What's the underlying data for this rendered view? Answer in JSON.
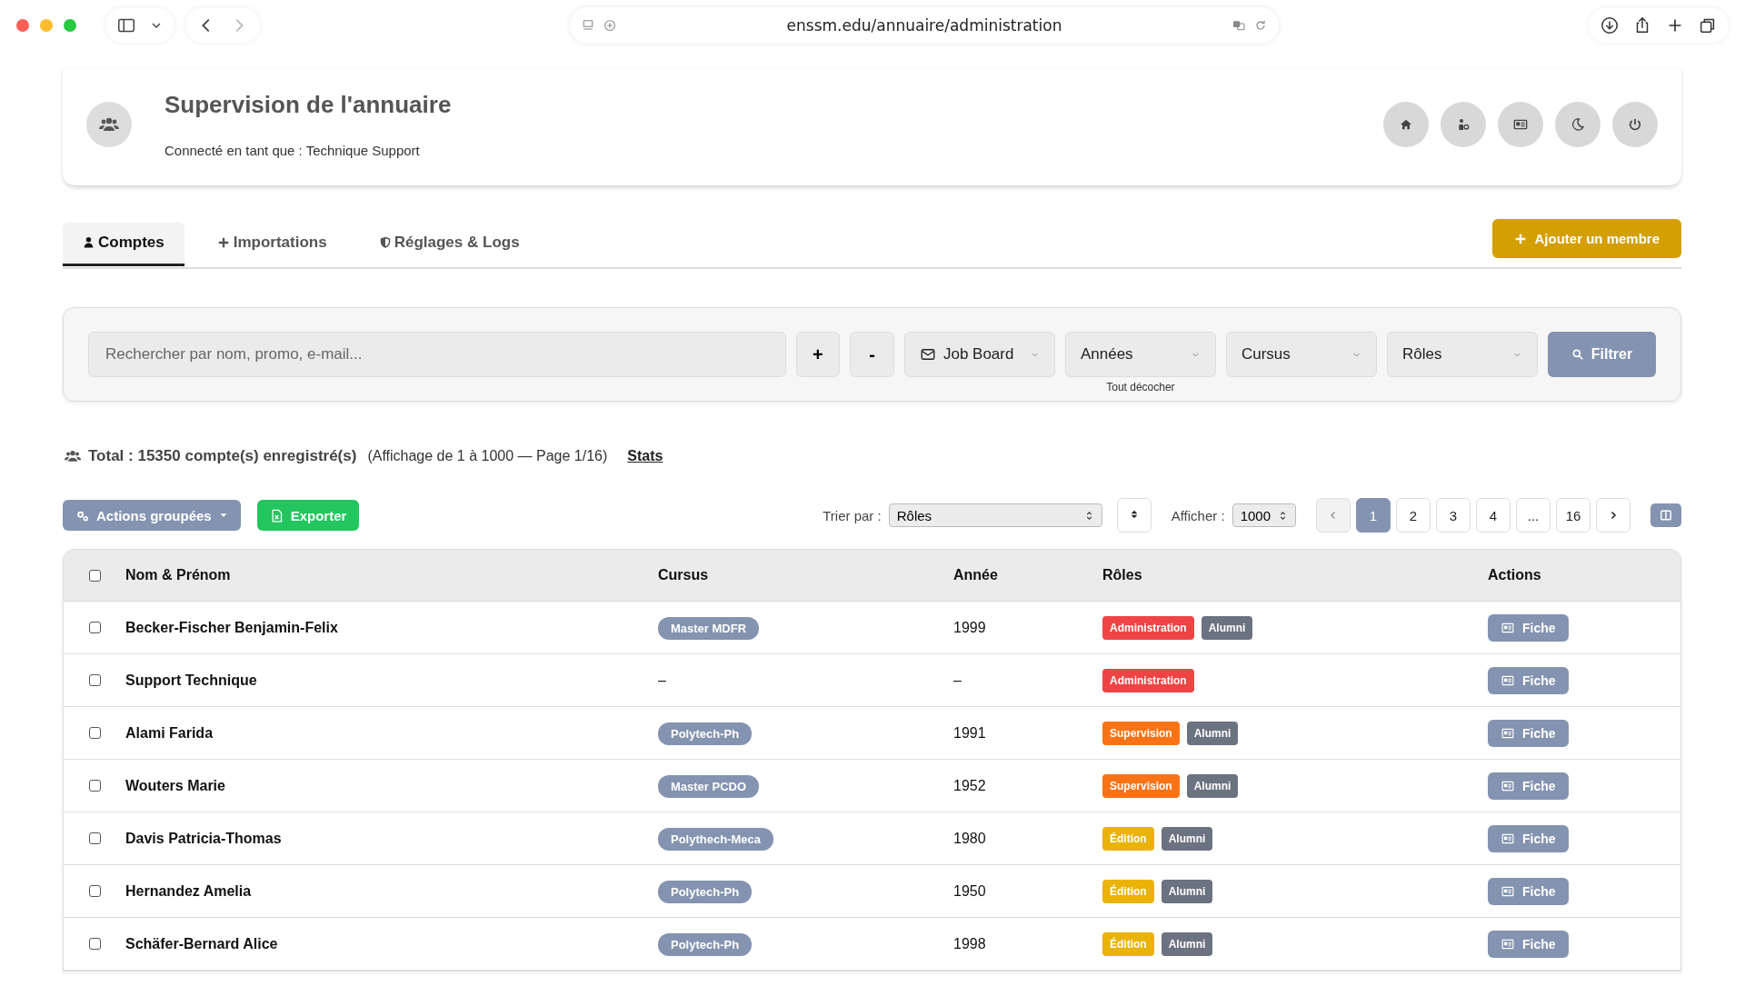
{
  "browser": {
    "url": "enssm.edu/annuaire/administration"
  },
  "header": {
    "title": "Supervision de l'annuaire",
    "subtitle": "Connecté en tant que : Technique Support"
  },
  "tabs": [
    {
      "label": "Comptes",
      "selected": true
    },
    {
      "label": "Importations",
      "selected": false
    },
    {
      "label": "Réglages & Logs",
      "selected": false
    }
  ],
  "add_button": "Ajouter un membre",
  "filters": {
    "search_placeholder": "Rechercher par nom, promo, e-mail...",
    "plus": "+",
    "minus": "-",
    "dropdowns": [
      "Job Board",
      "Années",
      "Cursus",
      "Rôles"
    ],
    "hint": "Tout décocher",
    "filter_button": "Filtrer"
  },
  "summary": {
    "total": "Total : 15350 compte(s) enregistré(s)",
    "range": "(Affichage de 1 à 1000 — Page 1/16)",
    "stats_link": "Stats"
  },
  "toolbar": {
    "bulk": "Actions groupées",
    "export": "Exporter",
    "sort_label": "Trier par :",
    "sort_value": "Rôles",
    "show_label": "Afficher :",
    "show_value": "1000",
    "pages": [
      {
        "label": "1",
        "selected": true
      },
      {
        "label": "2",
        "selected": false
      },
      {
        "label": "3",
        "selected": false
      },
      {
        "label": "4",
        "selected": false
      },
      {
        "label": "...",
        "selected": false
      },
      {
        "label": "16",
        "selected": false
      }
    ]
  },
  "table": {
    "select_all_checked": false,
    "columns": [
      "Nom & Prénom",
      "Cursus",
      "Année",
      "Rôles",
      "Actions"
    ],
    "rows": [
      {
        "checked": false,
        "name": "Becker-Fischer Benjamin-Felix",
        "cursus": "Master MDFR",
        "year": "1999",
        "roles": [
          {
            "label": "Administration",
            "color": "#ef4444"
          },
          {
            "label": "Alumni",
            "color": "#6b7280"
          }
        ],
        "action": "Fiche"
      },
      {
        "checked": false,
        "name": "Support Technique",
        "cursus": "–",
        "year": "–",
        "roles": [
          {
            "label": "Administration",
            "color": "#ef4444"
          }
        ],
        "action": "Fiche"
      },
      {
        "checked": false,
        "name": "Alami Farida",
        "cursus": "Polytech-Ph",
        "year": "1991",
        "roles": [
          {
            "label": "Supervision",
            "color": "#f97316"
          },
          {
            "label": "Alumni",
            "color": "#6b7280"
          }
        ],
        "action": "Fiche"
      },
      {
        "checked": false,
        "name": "Wouters Marie",
        "cursus": "Master PCDO",
        "year": "1952",
        "roles": [
          {
            "label": "Supervision",
            "color": "#f97316"
          },
          {
            "label": "Alumni",
            "color": "#6b7280"
          }
        ],
        "action": "Fiche"
      },
      {
        "checked": false,
        "name": "Davis Patricia-Thomas",
        "cursus": "Polythech-Meca",
        "year": "1980",
        "roles": [
          {
            "label": "Édition",
            "color": "#eab308"
          },
          {
            "label": "Alumni",
            "color": "#6b7280"
          }
        ],
        "action": "Fiche"
      },
      {
        "checked": false,
        "name": "Hernandez Amelia",
        "cursus": "Polytech-Ph",
        "year": "1950",
        "roles": [
          {
            "label": "Édition",
            "color": "#eab308"
          },
          {
            "label": "Alumni",
            "color": "#6b7280"
          }
        ],
        "action": "Fiche"
      },
      {
        "checked": false,
        "name": "Schäfer-Bernard Alice",
        "cursus": "Polytech-Ph",
        "year": "1998",
        "roles": [
          {
            "label": "Édition",
            "color": "#eab308"
          },
          {
            "label": "Alumni",
            "color": "#6b7280"
          }
        ],
        "action": "Fiche"
      }
    ]
  }
}
